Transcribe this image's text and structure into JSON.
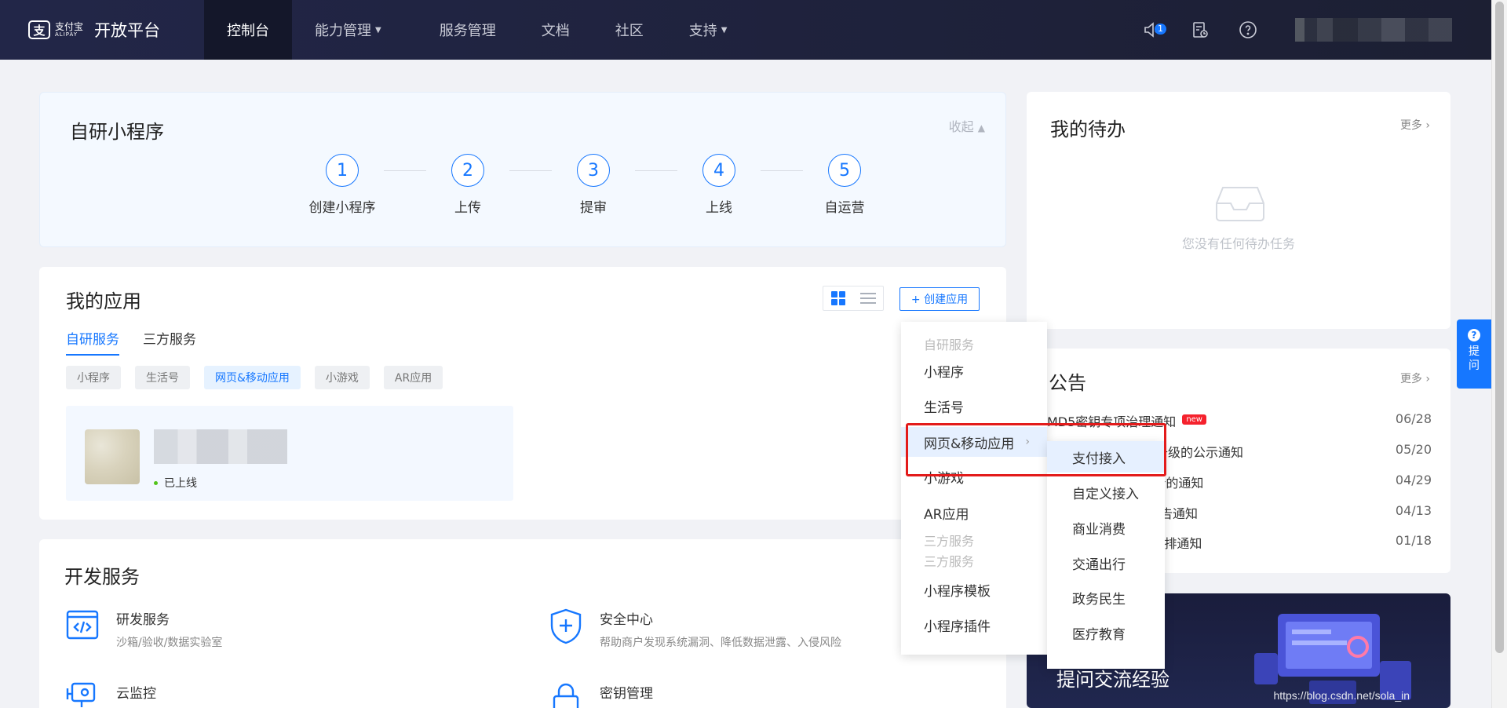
{
  "topnav": {
    "brand_cn": "支付宝",
    "brand_en": "ALIPAY",
    "platform": "开放平台",
    "items": [
      {
        "label": "控制台",
        "active": true,
        "dropdown": false
      },
      {
        "label": "能力管理",
        "active": false,
        "dropdown": true
      },
      {
        "label": "服务管理",
        "active": false,
        "dropdown": false
      },
      {
        "label": "文档",
        "active": false,
        "dropdown": false
      },
      {
        "label": "社区",
        "active": false,
        "dropdown": false
      },
      {
        "label": "支持",
        "active": false,
        "dropdown": true
      }
    ],
    "notification_count": "1"
  },
  "steps_card": {
    "title": "自研小程序",
    "collapse": "收起",
    "steps": [
      {
        "num": "1",
        "label": "创建小程序"
      },
      {
        "num": "2",
        "label": "上传"
      },
      {
        "num": "3",
        "label": "提审"
      },
      {
        "num": "4",
        "label": "上线"
      },
      {
        "num": "5",
        "label": "自运营"
      }
    ]
  },
  "apps_card": {
    "title": "我的应用",
    "create_button": "+ 创建应用",
    "tabs": [
      "自研服务",
      "三方服务"
    ],
    "chips": [
      "小程序",
      "生活号",
      "网页&移动应用",
      "小游戏",
      "AR应用"
    ],
    "active_chip": "网页&移动应用",
    "app_status": "已上线"
  },
  "dev_card": {
    "title": "开发服务",
    "services": [
      {
        "title": "研发服务",
        "desc": "沙箱/验收/数据实验室",
        "icon": "code-icon"
      },
      {
        "title": "安全中心",
        "desc": "帮助商户发现系统漏洞、降低数据泄露、入侵风险",
        "icon": "shield-plus-icon"
      },
      {
        "title": "云监控",
        "desc": "",
        "icon": "camera-icon"
      },
      {
        "title": "密钥管理",
        "desc": "",
        "icon": "lock-icon"
      }
    ]
  },
  "todo_card": {
    "title": "我的待办",
    "more": "更多",
    "empty": "您没有任何待办任务"
  },
  "notice_card": {
    "title": "公告",
    "more": "更多",
    "items": [
      {
        "text": "MD5密钥专项治理通知",
        "date": "06/28",
        "new": "new"
      },
      {
        "text": "议（SCI）评估模型升级的公示通知",
        "date": "05/20"
      },
      {
        "text": "核\"接口相关字段更新的通知",
        "date": "04/29"
      },
      {
        "text": "务行业管理规范》公告通知",
        "date": "04/13"
      },
      {
        "text": "序/生活号审核时间安排通知",
        "date": "01/18"
      }
    ]
  },
  "banner": {
    "text": "提问交流经验",
    "watermark": "https://blog.csdn.net/sola_in"
  },
  "help_float": {
    "q": "?",
    "label1": "提",
    "label2": "问"
  },
  "create_menu": {
    "group_self": "自研服务",
    "items_self": [
      "小程序",
      "生活号",
      "网页&移动应用",
      "小游戏",
      "AR应用"
    ],
    "group_third_1": "三方服务",
    "group_third_2": "三方服务",
    "items_third": [
      "小程序模板",
      "小程序插件"
    ],
    "submenu": [
      "支付接入",
      "自定义接入",
      "商业消费",
      "交通出行",
      "政务民生",
      "医疗教育"
    ]
  },
  "colors": {
    "accent": "#1677ff",
    "nav_bg": "#1c1f33",
    "highlight": "#e31b1b",
    "online": "#52c41a"
  }
}
